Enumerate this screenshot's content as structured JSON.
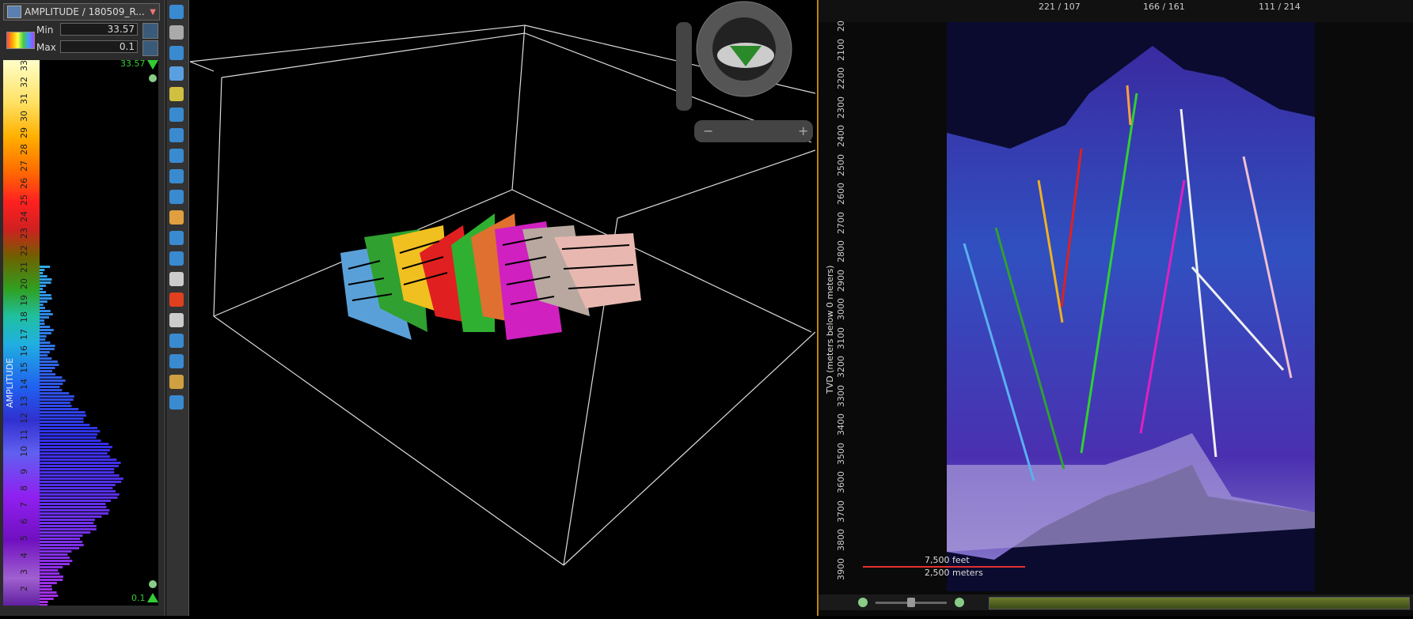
{
  "colorbar": {
    "attribute_title": "AMPLITUDE / 180509_R...",
    "min_label": "Min",
    "min_value": "33.57",
    "max_label": "Max",
    "max_value": "0.1",
    "top_value": "33.57",
    "bottom_value": "0.1",
    "axis_label": "AMPLITUDE",
    "ticks": [
      "33",
      "32",
      "31",
      "30",
      "29",
      "28",
      "27",
      "26",
      "25",
      "24",
      "23",
      "22",
      "21",
      "20",
      "19",
      "18",
      "17",
      "16",
      "15",
      "14",
      "13",
      "12",
      "11",
      "10",
      "9",
      "8",
      "7",
      "6",
      "5",
      "4",
      "3",
      "2"
    ]
  },
  "section": {
    "top_ruler_labels": [
      "221 / 107",
      "166 / 161",
      "111 / 214"
    ],
    "y_ticks": [
      "20",
      "2100",
      "2200",
      "2300",
      "2400",
      "2500",
      "2600",
      "2700",
      "2800",
      "2900",
      "3000",
      "3100",
      "3200",
      "3300",
      "3400",
      "3500",
      "3600",
      "3700",
      "3800",
      "3900"
    ],
    "y_axis_label": "TVD (meters below 0 meters)",
    "scale_feet": "7,500 feet",
    "scale_meters": "2,500 meters"
  },
  "toolbar": {
    "icons": [
      "select-icon",
      "zoom-icon",
      "rotate-icon",
      "pan-icon",
      "display-icon",
      "arrow-icon",
      "pointer-icon",
      "pick-icon",
      "measure-icon",
      "layers-icon",
      "palette-icon",
      "probe-icon",
      "pen-icon",
      "light-icon",
      "record-icon",
      "export-icon",
      "frame-icon",
      "snapshot-icon",
      "ruler-icon",
      "grid-icon"
    ]
  },
  "colors": {
    "accent": "#b8860b",
    "green_marker": "#33cc33"
  }
}
